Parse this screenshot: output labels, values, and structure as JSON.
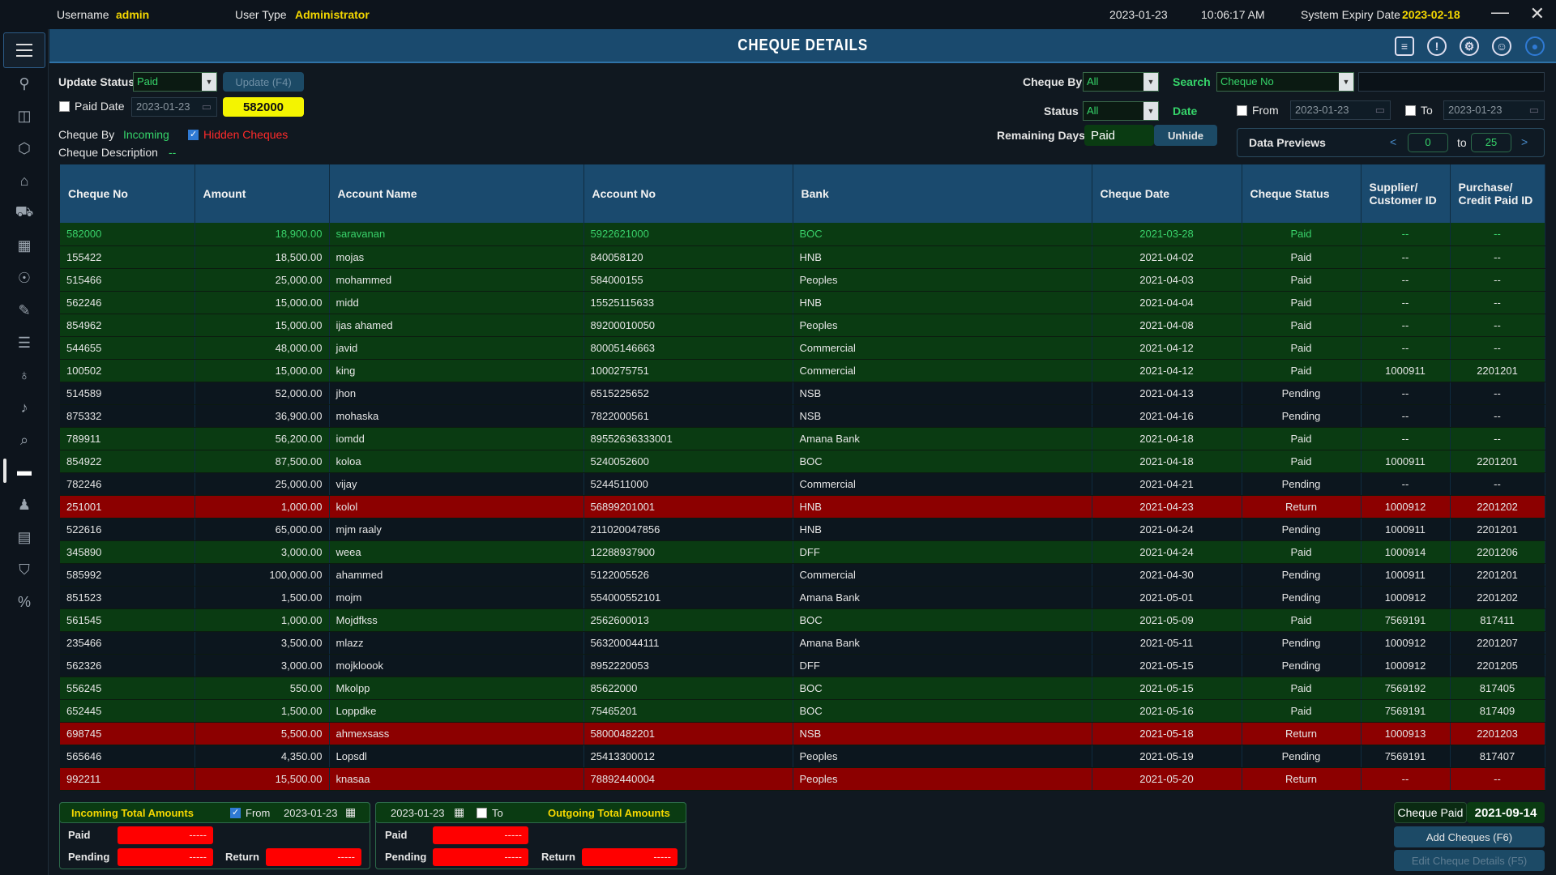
{
  "topbar": {
    "username_label": "Username",
    "username": "admin",
    "usertype_label": "User Type",
    "usertype": "Administrator",
    "date": "2023-01-23",
    "time": "10:06:17 AM",
    "expiry_label": "System Expiry Date",
    "expiry": "2023-02-18"
  },
  "header": {
    "title": "CHEQUE DETAILS"
  },
  "controls": {
    "update_status_label": "Update Status",
    "update_status_value": "Paid",
    "update_button": "Update (F4)",
    "paid_date_label": "Paid Date",
    "paid_date_value": "2023-01-23",
    "selected_cheque": "582000",
    "cheque_by_label": "Cheque By",
    "cheque_by_value": "Incoming",
    "hidden_cheques": "Hidden Cheques",
    "cheque_desc_label": "Cheque Description",
    "cheque_desc_value": "--",
    "filter_cheque_by_label": "Cheque By",
    "filter_cheque_by_value": "All",
    "search_label": "Search",
    "search_field": "Cheque No",
    "status_label": "Status",
    "status_value": "All",
    "date_label": "Date",
    "from_label": "From",
    "from_value": "2023-01-23",
    "to_label": "To",
    "to_value": "2023-01-23",
    "remaining_days_label": "Remaining Days",
    "remaining_days_value": "Paid",
    "unhide_button": "Unhide",
    "data_previews_label": "Data Previews",
    "prev": "<",
    "preview_from": "0",
    "preview_to_label": "to",
    "preview_to": "25",
    "next": ">"
  },
  "table": {
    "columns": [
      "Cheque No",
      "Amount",
      "Account Name",
      "Account No",
      "Bank",
      "Cheque Date",
      "Cheque Status",
      "Supplier/ Customer ID",
      "Purchase/ Credit Paid ID"
    ],
    "rows": [
      [
        "582000",
        "18,900.00",
        "saravanan",
        "5922621000",
        "BOC",
        "2021-03-28",
        "Paid",
        "--",
        "--"
      ],
      [
        "155422",
        "18,500.00",
        "mojas",
        "840058120",
        "HNB",
        "2021-04-02",
        "Paid",
        "--",
        "--"
      ],
      [
        "515466",
        "25,000.00",
        "mohammed",
        "584000155",
        "Peoples",
        "2021-04-03",
        "Paid",
        "--",
        "--"
      ],
      [
        "562246",
        "15,000.00",
        "midd",
        "15525115633",
        "HNB",
        "2021-04-04",
        "Paid",
        "--",
        "--"
      ],
      [
        "854962",
        "15,000.00",
        "ijas ahamed",
        "89200010050",
        "Peoples",
        "2021-04-08",
        "Paid",
        "--",
        "--"
      ],
      [
        "544655",
        "48,000.00",
        "javid",
        "80005146663",
        "Commercial",
        "2021-04-12",
        "Paid",
        "--",
        "--"
      ],
      [
        "100502",
        "15,000.00",
        "king",
        "1000275751",
        "Commercial",
        "2021-04-12",
        "Paid",
        "1000911",
        "2201201"
      ],
      [
        "514589",
        "52,000.00",
        "jhon",
        "6515225652",
        "NSB",
        "2021-04-13",
        "Pending",
        "--",
        "--"
      ],
      [
        "875332",
        "36,900.00",
        "mohaska",
        "7822000561",
        "NSB",
        "2021-04-16",
        "Pending",
        "--",
        "--"
      ],
      [
        "789911",
        "56,200.00",
        "iomdd",
        "89552636333001",
        "Amana Bank",
        "2021-04-18",
        "Paid",
        "--",
        "--"
      ],
      [
        "854922",
        "87,500.00",
        "koloa",
        "5240052600",
        "BOC",
        "2021-04-18",
        "Paid",
        "1000911",
        "2201201"
      ],
      [
        "782246",
        "25,000.00",
        "vijay",
        "5244511000",
        "Commercial",
        "2021-04-21",
        "Pending",
        "--",
        "--"
      ],
      [
        "251001",
        "1,000.00",
        "kolol",
        "56899201001",
        "HNB",
        "2021-04-23",
        "Return",
        "1000912",
        "2201202"
      ],
      [
        "522616",
        "65,000.00",
        "mjm raaly",
        "211020047856",
        "HNB",
        "2021-04-24",
        "Pending",
        "1000911",
        "2201201"
      ],
      [
        "345890",
        "3,000.00",
        "weea",
        "12288937900",
        "DFF",
        "2021-04-24",
        "Paid",
        "1000914",
        "2201206"
      ],
      [
        "585992",
        "100,000.00",
        "ahammed",
        "5122005526",
        "Commercial",
        "2021-04-30",
        "Pending",
        "1000911",
        "2201201"
      ],
      [
        "851523",
        "1,500.00",
        "mojm",
        "554000552101",
        "Amana Bank",
        "2021-05-01",
        "Pending",
        "1000912",
        "2201202"
      ],
      [
        "561545",
        "1,000.00",
        "Mojdfkss",
        "2562600013",
        "BOC",
        "2021-05-09",
        "Paid",
        "7569191",
        "817411"
      ],
      [
        "235466",
        "3,500.00",
        "mlazz",
        "563200044111",
        "Amana Bank",
        "2021-05-11",
        "Pending",
        "1000912",
        "2201207"
      ],
      [
        "562326",
        "3,000.00",
        "mojkloook",
        "8952220053",
        "DFF",
        "2021-05-15",
        "Pending",
        "1000912",
        "2201205"
      ],
      [
        "556245",
        "550.00",
        "Mkolpp",
        "85622000",
        "BOC",
        "2021-05-15",
        "Paid",
        "7569192",
        "817405"
      ],
      [
        "652445",
        "1,500.00",
        "Loppdke",
        "75465201",
        "BOC",
        "2021-05-16",
        "Paid",
        "7569191",
        "817409"
      ],
      [
        "698745",
        "5,500.00",
        "ahmexsass",
        "58000482201",
        "NSB",
        "2021-05-18",
        "Return",
        "1000913",
        "2201203"
      ],
      [
        "565646",
        "4,350.00",
        "Lopsdl",
        "25413300012",
        "Peoples",
        "2021-05-19",
        "Pending",
        "7569191",
        "817407"
      ],
      [
        "992211",
        "15,500.00",
        "knasaa",
        "78892440004",
        "Peoples",
        "2021-05-20",
        "Return",
        "--",
        "--"
      ]
    ]
  },
  "bottom": {
    "incoming_title": "Incoming Total Amounts",
    "from_label": "From",
    "from_date": "2023-01-23",
    "to_date": "2023-01-23",
    "to_label": "To",
    "outgoing_title": "Outgoing Total Amounts",
    "paid_label": "Paid",
    "pending_label": "Pending",
    "return_label": "Return",
    "empty_value": "-----",
    "cheque_paid_label": "Cheque Paid",
    "cheque_paid_date": "2021-09-14",
    "add_button": "Add Cheques (F6)",
    "edit_button": "Edit Cheque Details (F5)"
  },
  "colors": {
    "paid_row": "#0a3b12",
    "pending_row": "#0c161e",
    "return_row": "#8c0000",
    "header_blue": "#1a4a6e",
    "accent_yellow": "#f5d800"
  }
}
